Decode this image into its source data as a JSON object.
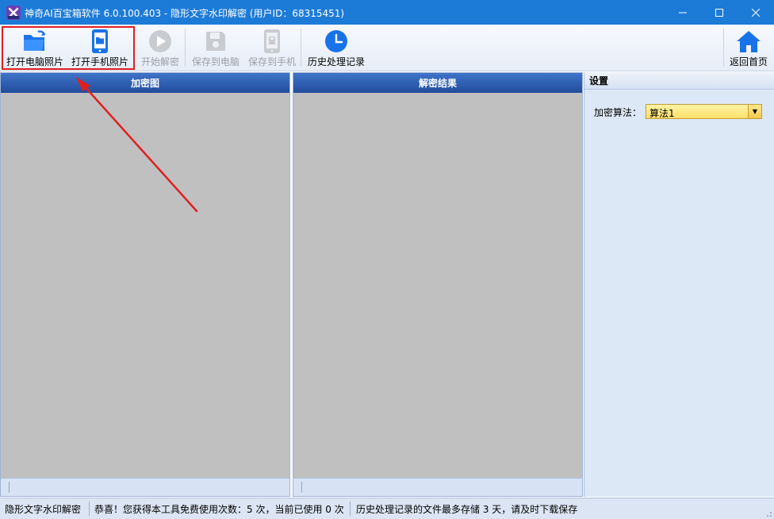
{
  "window": {
    "title": "神奇AI百宝箱软件 6.0.100.403 - 隐形文字水印解密 (用户ID：68315451)",
    "app_icon": "magic-box-icon"
  },
  "toolbar": {
    "open_pc_label": "打开电脑照片",
    "open_phone_label": "打开手机照片",
    "start_decrypt_label": "开始解密",
    "save_pc_label": "保存到电脑",
    "save_phone_label": "保存到手机",
    "history_label": "历史处理记录",
    "home_label": "返回首页"
  },
  "panels": {
    "encrypted_title": "加密图",
    "result_title": "解密结果"
  },
  "settings": {
    "title": "设置",
    "algorithm_label": "加密算法：",
    "algorithm_value": "算法1"
  },
  "statusbar": {
    "mode": "隐形文字水印解密",
    "usage": "恭喜！您获得本工具免费使用次数：5 次，当前已使用 0 次",
    "retention": "历史处理记录的文件最多存储 3 天，请及时下载保存"
  },
  "colors": {
    "titlebar": "#1d7bd8",
    "accent_blue": "#1873e8",
    "highlight_red": "#e02020",
    "panel_header": "#2d5db0",
    "canvas_gray": "#c0c0c0"
  }
}
